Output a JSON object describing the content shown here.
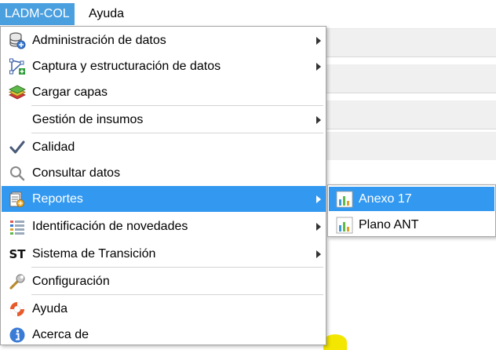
{
  "menubar": {
    "items": [
      {
        "label": "LADM-COL",
        "active": true
      },
      {
        "label": "Ayuda",
        "active": false
      }
    ]
  },
  "menu": {
    "items": [
      {
        "label": "Administración de datos",
        "icon": "database-add-icon",
        "submenu": true
      },
      {
        "label": "Captura y estructuración de datos",
        "icon": "vertex-edit-icon",
        "submenu": true
      },
      {
        "label": "Cargar capas",
        "icon": "layers-icon",
        "submenu": false
      },
      {
        "label": "Gestión de insumos",
        "icon": "",
        "submenu": true
      },
      {
        "label": "Calidad",
        "icon": "checkmark-icon",
        "submenu": false
      },
      {
        "label": "Consultar datos",
        "icon": "search-icon",
        "submenu": false
      },
      {
        "label": "Reportes",
        "icon": "report-icon",
        "submenu": true,
        "highlighted": true
      },
      {
        "label": "Identificación de novedades",
        "icon": "changes-icon",
        "submenu": true
      },
      {
        "label": "Sistema de Transición",
        "icon": "st-icon",
        "icon_text": "ST",
        "submenu": true
      },
      {
        "label": "Configuración",
        "icon": "wrench-icon",
        "submenu": false
      },
      {
        "label": "Ayuda",
        "icon": "lifebuoy-icon",
        "submenu": false
      },
      {
        "label": "Acerca de",
        "icon": "info-icon",
        "submenu": false
      }
    ]
  },
  "submenu": {
    "items": [
      {
        "label": "Anexo 17",
        "icon": "bar-chart-icon",
        "highlighted": true
      },
      {
        "label": "Plano ANT",
        "icon": "bar-chart-icon",
        "highlighted": false
      }
    ]
  },
  "colors": {
    "highlight": "#3399f0",
    "menubar_active": "#4a9fdf"
  }
}
